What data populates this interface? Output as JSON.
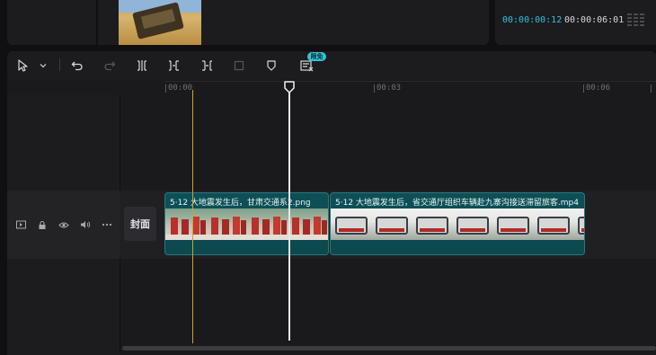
{
  "player": {
    "current_time": "00:00:00:12",
    "total_time": "00:00:06:01"
  },
  "toolbar": {
    "tools": [
      {
        "name": "select-tool",
        "icon": "cursor-icon"
      },
      {
        "name": "select-mode-dropdown",
        "icon": "chevron-down-icon"
      },
      {
        "name": "undo",
        "icon": "undo-icon"
      },
      {
        "name": "redo",
        "icon": "redo-icon"
      },
      {
        "name": "split",
        "icon": "split-icon"
      },
      {
        "name": "delete-left",
        "icon": "trim-left-icon"
      },
      {
        "name": "delete-right",
        "icon": "trim-right-icon"
      },
      {
        "name": "delete",
        "icon": "delete-box-icon"
      },
      {
        "name": "marker",
        "icon": "marker-icon"
      },
      {
        "name": "captions",
        "icon": "caption-icon"
      }
    ],
    "badge": "限免"
  },
  "ruler": {
    "labels": [
      "00:00",
      "00:03",
      "00:06"
    ]
  },
  "track": {
    "cover_label": "封面",
    "icons": [
      "screen-icon",
      "lock-icon",
      "eye-icon",
      "speaker-icon",
      "more-icon"
    ]
  },
  "clips": [
    {
      "label": "5·12 大地震发生后，甘肃交通系2.png"
    },
    {
      "label": "5·12 大地震发生后，省交通厅组织车辆赴九寨沟接送滞留旅客.mp4"
    }
  ],
  "colors": {
    "accent": "#2fc4d6",
    "clip": "#0e4f55",
    "marker": "#c9a431"
  }
}
